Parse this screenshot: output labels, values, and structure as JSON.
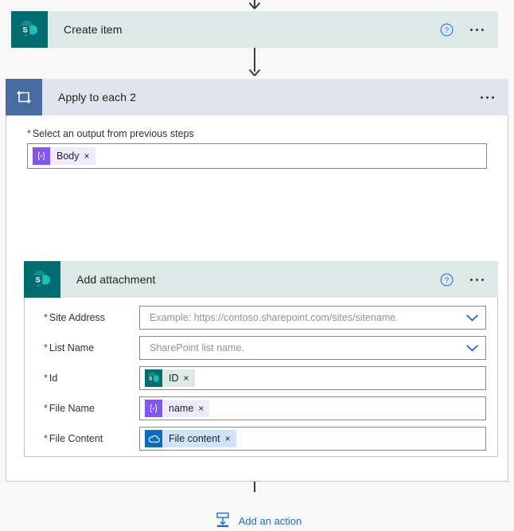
{
  "flow": {
    "create_item": {
      "title": "Create item",
      "icon": "sharepoint-icon",
      "help_icon": "help-circle-icon",
      "menu_icon": "more-options-icon"
    },
    "apply_to_each": {
      "title": "Apply to each 2",
      "icon": "loop-icon",
      "menu_icon": "more-options-icon",
      "select_output": {
        "label": "Select an output from previous steps",
        "required_marker": "*",
        "token": {
          "text": "Body",
          "icon": "expression-icon",
          "icon_glyph": "{x}",
          "close": "×",
          "kind": "expression"
        }
      },
      "add_attachment": {
        "title": "Add attachment",
        "icon": "sharepoint-icon",
        "help_icon": "help-circle-icon",
        "menu_icon": "more-options-icon",
        "fields": [
          {
            "label": "Site Address",
            "required_marker": "*",
            "type": "combobox",
            "placeholder": "Example: https://contoso.sharepoint.com/sites/sitename.",
            "chevron_icon": "chevron-down-icon"
          },
          {
            "label": "List Name",
            "required_marker": "*",
            "type": "combobox",
            "placeholder": "SharePoint list name.",
            "chevron_icon": "chevron-down-icon"
          },
          {
            "label": "Id",
            "required_marker": "*",
            "type": "token",
            "token": {
              "text": "ID",
              "icon": "sharepoint-icon",
              "icon_glyph": "S",
              "close": "×",
              "kind": "sharepoint"
            }
          },
          {
            "label": "File Name",
            "required_marker": "*",
            "type": "token",
            "token": {
              "text": "name",
              "icon": "expression-icon",
              "icon_glyph": "{x}",
              "close": "×",
              "kind": "expression"
            }
          },
          {
            "label": "File Content",
            "required_marker": "*",
            "type": "token",
            "token": {
              "text": "File content",
              "icon": "onedrive-cloud-icon",
              "icon_glyph": "☁",
              "close": "×",
              "kind": "onedrive"
            }
          }
        ]
      },
      "add_action": {
        "label": "Add an action",
        "icon": "insert-below-icon"
      }
    }
  },
  "colors": {
    "sharepoint_teal": "#036c70",
    "sharepoint_header": "#dce9e6",
    "loop_blue": "#486ca1",
    "loop_header": "#e1e4ed",
    "expression_purple": "#8056f5",
    "onedrive_blue": "#0f6cbd",
    "link_blue": "#1f6bcc",
    "required_red": "#a4262c",
    "canvas": "#f8f8f8"
  }
}
